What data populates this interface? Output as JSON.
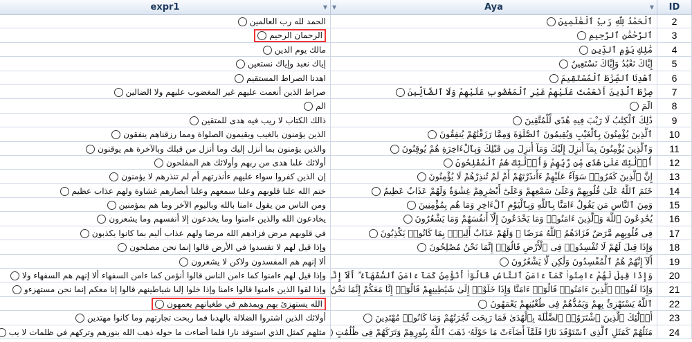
{
  "headers": {
    "expr": "expr1",
    "aya": "Aya",
    "id": "ID"
  },
  "accent": {
    "highlight": "#e33333",
    "header_bg": "#dde6f2"
  },
  "rows": [
    {
      "id": "2",
      "expr": "الحمد لله رب العالمين",
      "aya": "ٱلْحَمْدُ لِلَّهِ رَبِّ ٱلْعَٰلَمِينَ",
      "hl": false
    },
    {
      "id": "3",
      "expr": "الرحمان الرحيم",
      "aya": "ٱلرَّحْمَٰنِ ٱلرَّحِيمِ",
      "hl": true
    },
    {
      "id": "4",
      "expr": "مالك يوم الدين",
      "aya": "مَٰلِكِ يَوْمِ ٱلدِّينِ",
      "hl": false
    },
    {
      "id": "5",
      "expr": "إياك نعبد وإياك نستعين",
      "aya": "إِيَّاكَ نَعْبُدُ وَإِيَّاكَ نَسْتَعِينُ",
      "hl": false
    },
    {
      "id": "6",
      "expr": "اهدنا الصراط المستقيم",
      "aya": "ٱهْدِنَا ٱلصِّرَٰطَ ٱلْمُسْتَقِيمَ",
      "hl": false
    },
    {
      "id": "7",
      "expr": "صراط الذين أنعمت عليهم غير المغضوب عليهم ولا الضالين",
      "aya": "صِرَٰطَ ٱلَّذِينَ أَنْعَمْتَ عَلَيْهِمْ غَيْرِ ٱلْمَغْضُوبِ عَلَيْهِمْ وَلَا ٱلضَّآلِّينَ",
      "hl": false
    },
    {
      "id": "8",
      "expr": "الم",
      "aya": "الٓمٓ",
      "hl": false
    },
    {
      "id": "9",
      "expr": "ذالك الكتاب لا ريب فيه هدى للمتقين",
      "aya": "ذَٰلِكَ ٱلْكِتَٰبُ لَا رَيْبَ فِيهِ هُدًى لِّلْمُتَّقِينَ",
      "hl": false
    },
    {
      "id": "10",
      "expr": "الذين يؤمنون بالغيب ويقيمون الصلواة ومما رزقناهم ينفقون",
      "aya": "ٱلَّذِينَ يُؤْمِنُونَ بِٱلْغَيْبِ وَيُقِيمُونَ ٱلصَّلَوٰةَ وَمِمَّا رَزَقْنَٰهُمْ يُنفِقُونَ",
      "hl": false
    },
    {
      "id": "11",
      "expr": "والذين يؤمنون بما أنزل إليك وما أنزل من قبلك وبالآخرة هم يوقنون",
      "aya": "وَٱلَّذِينَ يُؤْمِنُونَ بِمَآ أُنزِلَ إِلَيْكَ وَمَآ أُنزِلَ مِن قَبْلِكَ وَبِٱلْءَاخِرَةِ هُمْ يُوقِنُونَ",
      "hl": false
    },
    {
      "id": "12",
      "expr": "أولائك علىا هدى من ربهم وأولائك هم المفلحون",
      "aya": "أُو۟لَٰٓئِكَ عَلَىٰ هُدًى مِّن رَّبِّهِمْ وَأُو۟لَٰٓئِكَ هُمُ ٱلْمُفْلِحُونَ",
      "hl": false
    },
    {
      "id": "13",
      "expr": "إن الذين كفروا سواء عليهم ءأنذرتهم أم لم تنذرهم لا يؤمنون",
      "aya": "إِنَّ ٱلَّذِينَ كَفَرُوا۟ سَوَآءٌ عَلَيْهِمْ ءَأَنذَرْتَهُمْ أَمْ لَمْ تُنذِرْهُمْ لَا يُؤْمِنُونَ",
      "hl": false
    },
    {
      "id": "14",
      "expr": "ختم الله علىا قلوبهم وعلىا سمعهم وعلىا أبصارهم غشاوة ولهم عذاب عظيم",
      "aya": "خَتَمَ ٱللَّهُ عَلَىٰ قُلُوبِهِمْ وَعَلَىٰ سَمْعِهِمْ وَعَلَىٰٓ أَبْصَٰرِهِمْ غِشَٰوَةٌ وَلَهُمْ عَذَابٌ عَظِيمٌ",
      "hl": false
    },
    {
      "id": "15",
      "expr": "ومن الناس من يقول ءامنا بالله وباليوم الآخر وما هم بمؤمنين",
      "aya": "وَمِنَ ٱلنَّاسِ مَن يَقُولُ ءَامَنَّا بِٱللَّهِ وَبِٱلْيَوْمِ ٱلْءَاخِرِ وَمَا هُم بِمُؤْمِنِينَ",
      "hl": false
    },
    {
      "id": "16",
      "expr": "يخادعون الله والذين ءامنوا وما يخدعون إلا أنفسهم وما يشعرون",
      "aya": "يُخَٰدِعُونَ ٱللَّهَ وَٱلَّذِينَ ءَامَنُوا۟ وَمَا يَخْدَعُونَ إِلَّآ أَنفُسَهُمْ وَمَا يَشْعُرُونَ",
      "hl": false
    },
    {
      "id": "17",
      "expr": "في قلوبهم مرض فزادهم الله مرضا ولهم عذاب أليم بما كانوا يكذبون",
      "aya": "فِى قُلُوبِهِم مَّرَضٌ فَزَادَهُمُ ٱللَّهُ مَرَضًا ۖ وَلَهُمْ عَذَابٌ أَلِيمٌۢ بِمَا كَانُوا۟ يَكْذِبُونَ",
      "hl": false
    },
    {
      "id": "18",
      "expr": "وإذا قيل لهم لا تفسدوا في الأرض قالوا إنما نحن مصلحون",
      "aya": "وَإِذَا قِيلَ لَهُمْ لَا تُفْسِدُوا۟ فِى ٱلْأَرْضِ قَالُوٓا۟ إِنَّمَا نَحْنُ مُصْلِحُونَ",
      "hl": false
    },
    {
      "id": "19",
      "expr": "ألا إنهم هم المفسدون ولاكن لا يشعرون",
      "aya": "أَلَآ إِنَّهُمْ هُمُ ٱلْمُفْسِدُونَ وَلَٰكِن لَّا يَشْعُرُونَ",
      "hl": false
    },
    {
      "id": "20",
      "expr": "وإذا قيل لهم ءامنوا كما ءامن الناس قالوا أنؤمن كما ءامن السفهاء ألا إنهم هم السفهاء ولا",
      "aya": "وَإِذَا قِيلَ لَهُمْ ءَامِنُوا۟ كَمَآ ءَامَنَ ٱلنَّاسُ قَالُوٓا۟ أَنُؤْمِنُ كَمَآ ءَامَنَ ٱلسُّفَهَآءُ ۗ أَلَآ إِنَّهُمْ هُمُ ٱلسُّفَهَآءُ",
      "hl": false
    },
    {
      "id": "21",
      "expr": "وإذا لقوا الذين ءامنوا قالوا ءامنا وإذا خلوا إلىا شياطينهم قالوا إنا معكم إنما نحن مستهزءو",
      "aya": "وَإِذَا لَقُوا۟ ٱلَّذِينَ ءَامَنُوا۟ قَالُوٓا۟ ءَامَنَّا وَإِذَا خَلَوْا۟ إِلَىٰ شَيَٰطِينِهِمْ قَالُوٓا۟ إِنَّا مَعَكُمْ إِنَّمَا نَحْنُ مُسْتَهْزِءُونَ",
      "hl": false
    },
    {
      "id": "22",
      "expr": "الله يستهزئ بهم ويمدهم في طغيانهم يعمهون",
      "aya": "ٱللَّهُ يَسْتَهْزِئُ بِهِمْ وَيَمُدُّهُمْ فِى طُغْيَٰنِهِمْ يَعْمَهُونَ",
      "hl": true
    },
    {
      "id": "23",
      "expr": "أولائك الذين اشتروا الضلالة بالهدىا فما ربحت تجارتهم وما كانوا مهتدين",
      "aya": "أُو۟لَٰٓئِكَ ٱلَّذِينَ ٱشْتَرَوُا۟ ٱلضَّلَٰلَةَ بِٱلْهُدَىٰ فَمَا رَبِحَت تِّجَٰرَتُهُمْ وَمَا كَانُوا۟ مُهْتَدِينَ",
      "hl": false
    },
    {
      "id": "24",
      "expr": "مثلهم كمثل الذي استوقد نارا فلما أضاءت ما حوله ذهب الله بنورهم وتركهم في ظلمات لا يب",
      "aya": "مَثَلُهُمْ كَمَثَلِ ٱلَّذِى ٱسْتَوْقَدَ نَارًا فَلَمَّآ أَضَآءَتْ مَا حَوْلَهُۥ ذَهَبَ ٱللَّهُ بِنُورِهِمْ وَتَرَكَهُمْ فِى ظُلُمَٰتٍ",
      "hl": false
    }
  ]
}
